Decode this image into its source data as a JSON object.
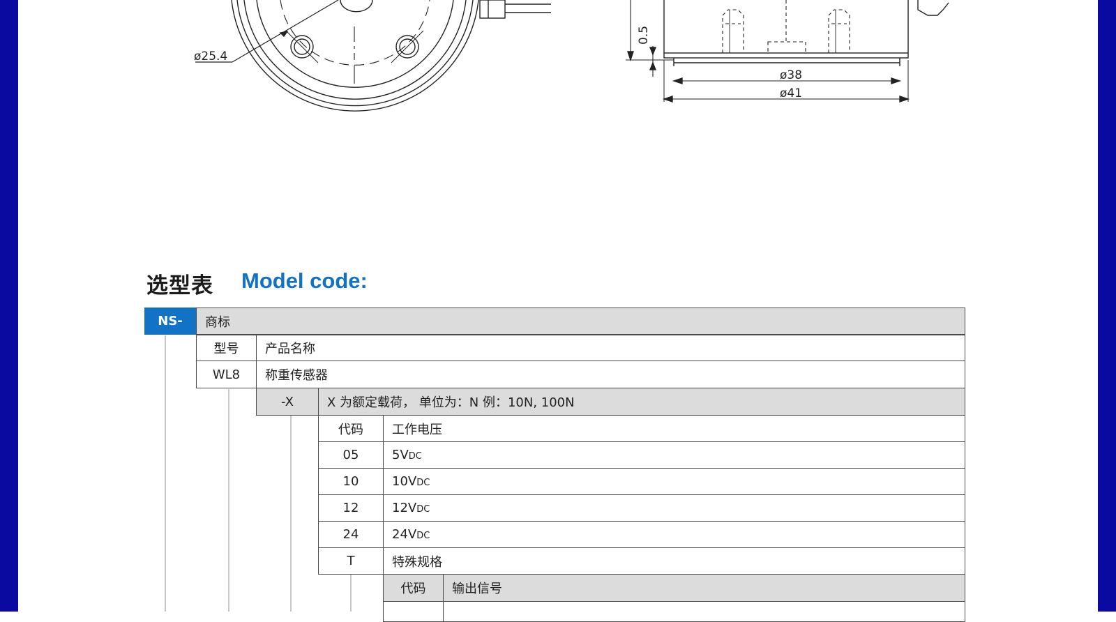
{
  "drawing": {
    "dim_left_diameter": "ø25.4",
    "dim_thickness": "0.5",
    "dim_inner_diameter": "ø38",
    "dim_outer_diameter": "ø41"
  },
  "section": {
    "title_cn": "选型表",
    "title_en": "Model code:"
  },
  "table": {
    "brand": {
      "code": "NS-",
      "label": "商标"
    },
    "model": {
      "header_code": "型号",
      "header_label": "产品名称",
      "code": "WL8",
      "label": "称重传感器"
    },
    "load": {
      "code": "-X",
      "label": "X 为额定载荷， 单位为：N 例：10N, 100N"
    },
    "voltage": {
      "header_code": "代码",
      "header_label": "工作电压",
      "rows": [
        {
          "code": "05",
          "value": "5V",
          "sub": "DC"
        },
        {
          "code": "10",
          "value": "10V",
          "sub": "DC"
        },
        {
          "code": "12",
          "value": "12V",
          "sub": "DC"
        },
        {
          "code": "24",
          "value": "24V",
          "sub": "DC"
        },
        {
          "code": "T",
          "value": "特殊规格",
          "sub": ""
        }
      ]
    },
    "output": {
      "header_code": "代码",
      "header_label": "输出信号"
    }
  }
}
